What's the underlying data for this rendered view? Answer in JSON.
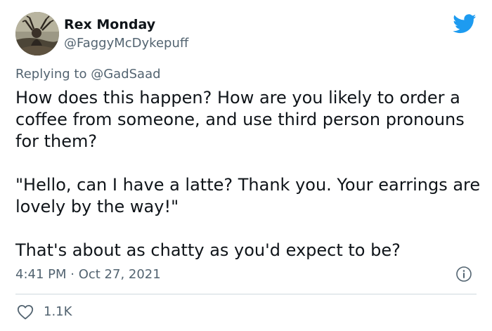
{
  "author": {
    "display_name": "Rex Monday",
    "handle": "@FaggyMcDykepuff"
  },
  "reply": {
    "prefix": "Replying to",
    "to_handle": "@GadSaad"
  },
  "tweet": {
    "paragraphs": [
      "How does this happen? How are you likely to order a coffee from someone, and use third person pronouns for them?",
      "\"Hello, can I have a latte? Thank you. Your earrings are lovely by the way!\"",
      "That's about as chatty as you'd expect to be?"
    ],
    "timestamp": "4:41 PM · Oct 27, 2021",
    "likes": "1.1K"
  },
  "icons": {
    "brand": "twitter-bird-icon",
    "info": "info-icon",
    "like": "heart-icon"
  },
  "colors": {
    "brand": "#1d9bf0",
    "secondary_text": "#536471",
    "primary_text": "#0f1419",
    "divider": "#cfd9de"
  }
}
